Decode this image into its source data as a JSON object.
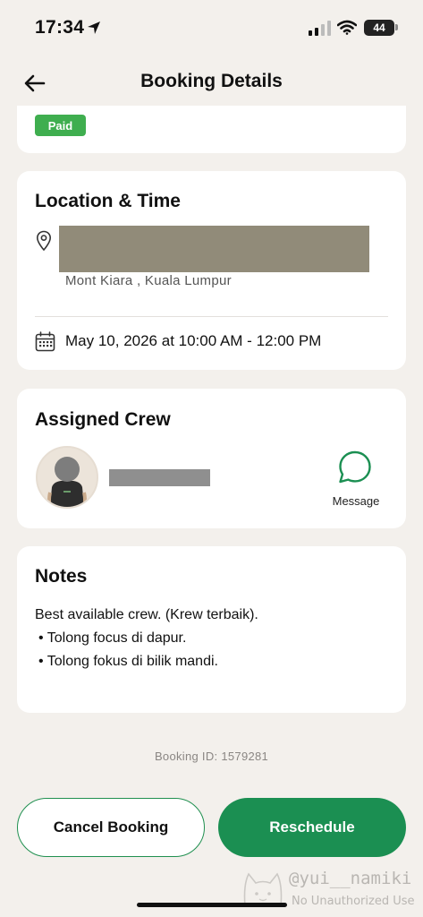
{
  "status_bar": {
    "time": "17:34",
    "battery": "44"
  },
  "header": {
    "title": "Booking Details"
  },
  "payment": {
    "badge": "Paid"
  },
  "location_time": {
    "title": "Location & Time",
    "area": "Mont Kiara , Kuala Lumpur",
    "datetime": "May 10, 2026 at 10:00 AM - 12:00 PM"
  },
  "crew": {
    "title": "Assigned Crew",
    "message_label": "Message"
  },
  "notes": {
    "title": "Notes",
    "lines": [
      "Best available crew. (Krew terbaik).",
      "• Tolong focus di dapur.",
      "• Tolong fokus di bilik mandi."
    ]
  },
  "booking": {
    "id_text": "Booking ID: 1579281"
  },
  "actions": {
    "cancel_label": "Cancel Booking",
    "reschedule_label": "Reschedule"
  },
  "watermark": {
    "handle": "@yui__namiki",
    "notice": "No Unauthorized Use"
  },
  "colors": {
    "accent": "#1b8f52",
    "paid": "#3fae4f",
    "background": "#f3f0ec"
  }
}
